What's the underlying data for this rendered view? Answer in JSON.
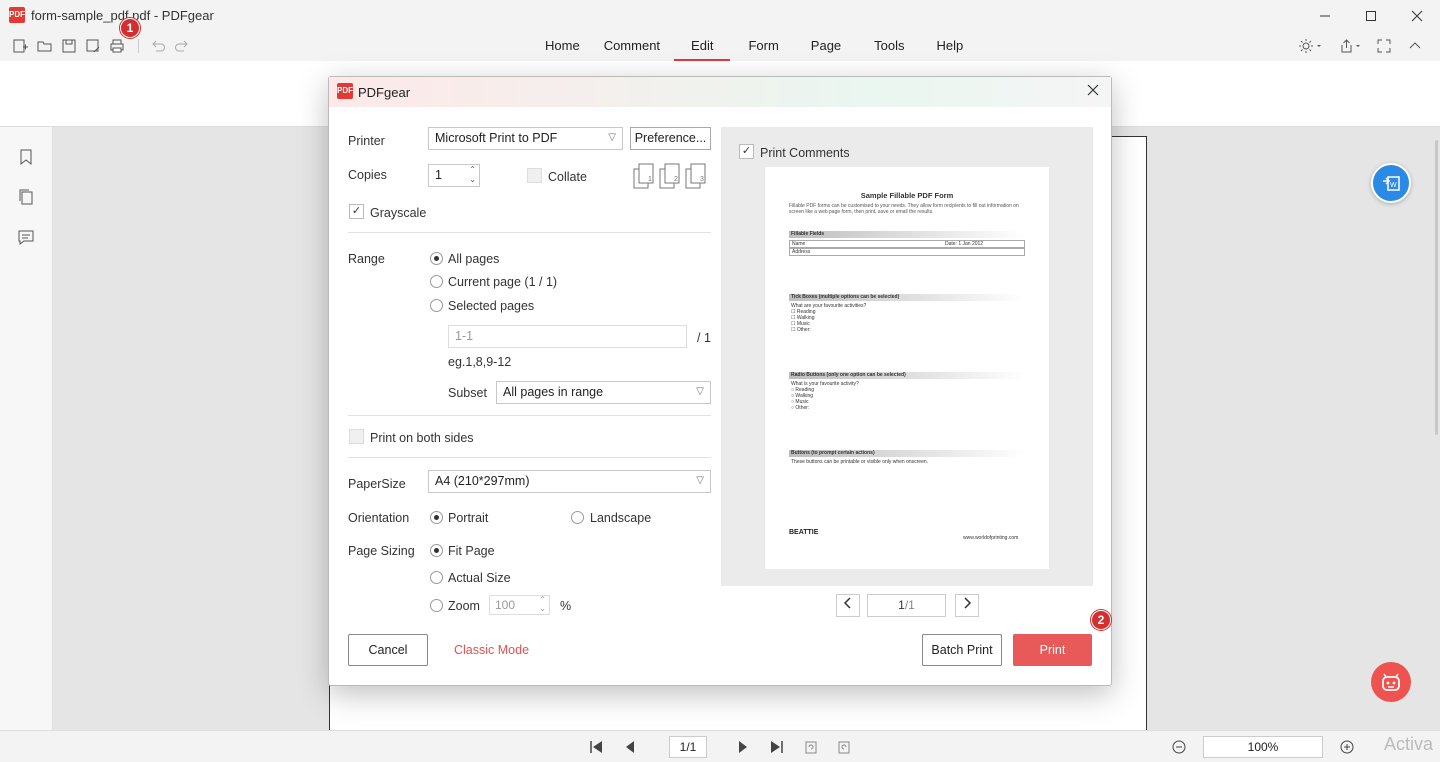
{
  "window": {
    "title": "form-sample_pdf.pdf - PDFgear",
    "logo_text": "PDF"
  },
  "tabs": [
    "Home",
    "Comment",
    "Edit",
    "Form",
    "Page",
    "Tools",
    "Help"
  ],
  "active_tab": "Edit",
  "dialog": {
    "title": "PDFgear",
    "printer_label": "Printer",
    "printer_value": "Microsoft Print to PDF",
    "preferences_label": "Preference...",
    "copies_label": "Copies",
    "copies_value": "1",
    "collate_label": "Collate",
    "grayscale_label": "Grayscale",
    "range_label": "Range",
    "range_all": "All pages",
    "range_current": "Current page (1 / 1)",
    "range_selected": "Selected pages",
    "range_input_placeholder": "1-1",
    "range_total": "/ 1",
    "range_hint": "eg.1,8,9-12",
    "subset_label": "Subset",
    "subset_value": "All pages in range",
    "both_sides_label": "Print on both sides",
    "papersize_label": "PaperSize",
    "papersize_value": "A4 (210*297mm)",
    "orientation_label": "Orientation",
    "orientation_portrait": "Portrait",
    "orientation_landscape": "Landscape",
    "page_sizing_label": "Page Sizing",
    "sizing_fit": "Fit Page",
    "sizing_actual": "Actual Size",
    "sizing_zoom": "Zoom",
    "zoom_value": "100",
    "zoom_unit": "%",
    "print_comments_label": "Print Comments",
    "preview_page": "1",
    "preview_total": "/1",
    "cancel_label": "Cancel",
    "classic_mode_label": "Classic Mode",
    "batch_print_label": "Batch Print",
    "print_label": "Print"
  },
  "preview_sheet": {
    "title": "Sample Fillable PDF Form",
    "intro": "Fillable PDF forms can be customised to your needs. They allow form recipients to fill out information on screen like a web page form, then print, save or email the results.",
    "sec1": "Fillable Fields",
    "name": "Name",
    "date": "Date: 1      Jan      2012",
    "address": "Address",
    "sec2": "Tick Boxes (multiple options can be selected)",
    "q2": "What are your favourite activities?",
    "opts2": [
      "☐ Reading",
      "☐ Walking",
      "☐ Music",
      "☐ Other:"
    ],
    "sec3": "Radio Buttons (only one option can be selected)",
    "q3": "What is your favourite activity?",
    "opts3": [
      "○ Reading",
      "○ Walking",
      "○ Music",
      "○ Other:"
    ],
    "sec4": "Buttons (to prompt certain actions)",
    "q4": "These buttons can be printable or visible only when onscreen.",
    "brand": "BEATTIE",
    "url": "www.worldofprinting.com"
  },
  "statusbar": {
    "page": "1/1",
    "zoom": "100%",
    "activate": "Activa"
  },
  "markers": [
    "1",
    "2"
  ],
  "colors": {
    "accent_red": "#e85a5a",
    "tab_underline": "#d93b3b",
    "fab_blue": "#2b8ae6",
    "fab_red": "#ef5350"
  }
}
